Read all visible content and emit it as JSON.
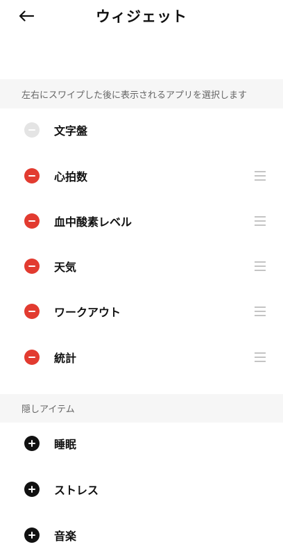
{
  "header": {
    "title": "ウィジェット",
    "back_icon": "arrow-left-icon"
  },
  "visible_section": {
    "description": "左右にスワイプした後に表示されるアプリを選択します",
    "items": [
      {
        "label": "文字盤",
        "action": "remove-disabled",
        "draggable": false
      },
      {
        "label": "心拍数",
        "action": "remove",
        "draggable": true
      },
      {
        "label": "血中酸素レベル",
        "action": "remove",
        "draggable": true
      },
      {
        "label": "天気",
        "action": "remove",
        "draggable": true
      },
      {
        "label": "ワークアウト",
        "action": "remove",
        "draggable": true
      },
      {
        "label": "統計",
        "action": "remove",
        "draggable": true
      }
    ]
  },
  "hidden_section": {
    "title": "隠しアイテム",
    "items": [
      {
        "label": "睡眠",
        "action": "add"
      },
      {
        "label": "ストレス",
        "action": "add"
      },
      {
        "label": "音楽",
        "action": "add"
      }
    ]
  },
  "colors": {
    "remove": "#e23b30",
    "disabled": "#e4e4e4",
    "add": "#111111",
    "section_bg": "#f6f6f6",
    "handle": "#c4c4c4"
  }
}
